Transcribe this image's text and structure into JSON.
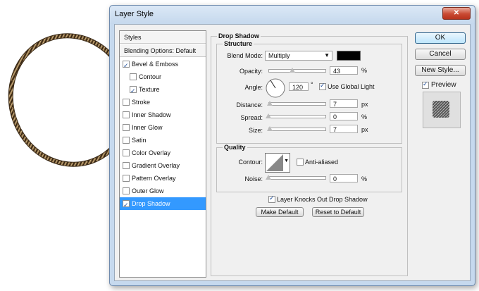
{
  "window": {
    "title": "Layer Style",
    "close_glyph": "✕"
  },
  "styles_panel": {
    "header": "Styles",
    "blending_options": "Blending Options: Default",
    "items": [
      {
        "label": "Bevel & Emboss",
        "checked": true,
        "indent": false
      },
      {
        "label": "Contour",
        "checked": false,
        "indent": true
      },
      {
        "label": "Texture",
        "checked": true,
        "indent": true
      },
      {
        "label": "Stroke",
        "checked": false,
        "indent": false
      },
      {
        "label": "Inner Shadow",
        "checked": false,
        "indent": false
      },
      {
        "label": "Inner Glow",
        "checked": false,
        "indent": false
      },
      {
        "label": "Satin",
        "checked": false,
        "indent": false
      },
      {
        "label": "Color Overlay",
        "checked": false,
        "indent": false
      },
      {
        "label": "Gradient Overlay",
        "checked": false,
        "indent": false
      },
      {
        "label": "Pattern Overlay",
        "checked": false,
        "indent": false
      },
      {
        "label": "Outer Glow",
        "checked": false,
        "indent": false
      },
      {
        "label": "Drop Shadow",
        "checked": true,
        "indent": false,
        "selected": true
      }
    ]
  },
  "drop_shadow": {
    "title": "Drop Shadow",
    "structure": {
      "title": "Structure",
      "blend_mode_label": "Blend Mode:",
      "blend_mode_value": "Multiply",
      "blend_color": "#000000",
      "opacity_label": "Opacity:",
      "opacity_value": "43",
      "opacity_unit": "%",
      "angle_label": "Angle:",
      "angle_value": "120",
      "angle_unit": "°",
      "use_global_light_label": "Use Global Light",
      "distance_label": "Distance:",
      "distance_value": "7",
      "distance_unit": "px",
      "spread_label": "Spread:",
      "spread_value": "0",
      "spread_unit": "%",
      "size_label": "Size:",
      "size_value": "7",
      "size_unit": "px"
    },
    "quality": {
      "title": "Quality",
      "contour_label": "Contour:",
      "anti_aliased_label": "Anti-aliased",
      "noise_label": "Noise:",
      "noise_value": "0",
      "noise_unit": "%"
    },
    "layer_knocks_out_label": "Layer Knocks Out Drop Shadow",
    "make_default_label": "Make Default",
    "reset_default_label": "Reset to Default"
  },
  "side_buttons": {
    "ok": "OK",
    "cancel": "Cancel",
    "new_style": "New Style...",
    "preview_label": "Preview"
  },
  "sliders": {
    "opacity": 0.43,
    "distance": 0.03,
    "spread": 0.0,
    "size": 0.03,
    "noise": 0.0
  }
}
